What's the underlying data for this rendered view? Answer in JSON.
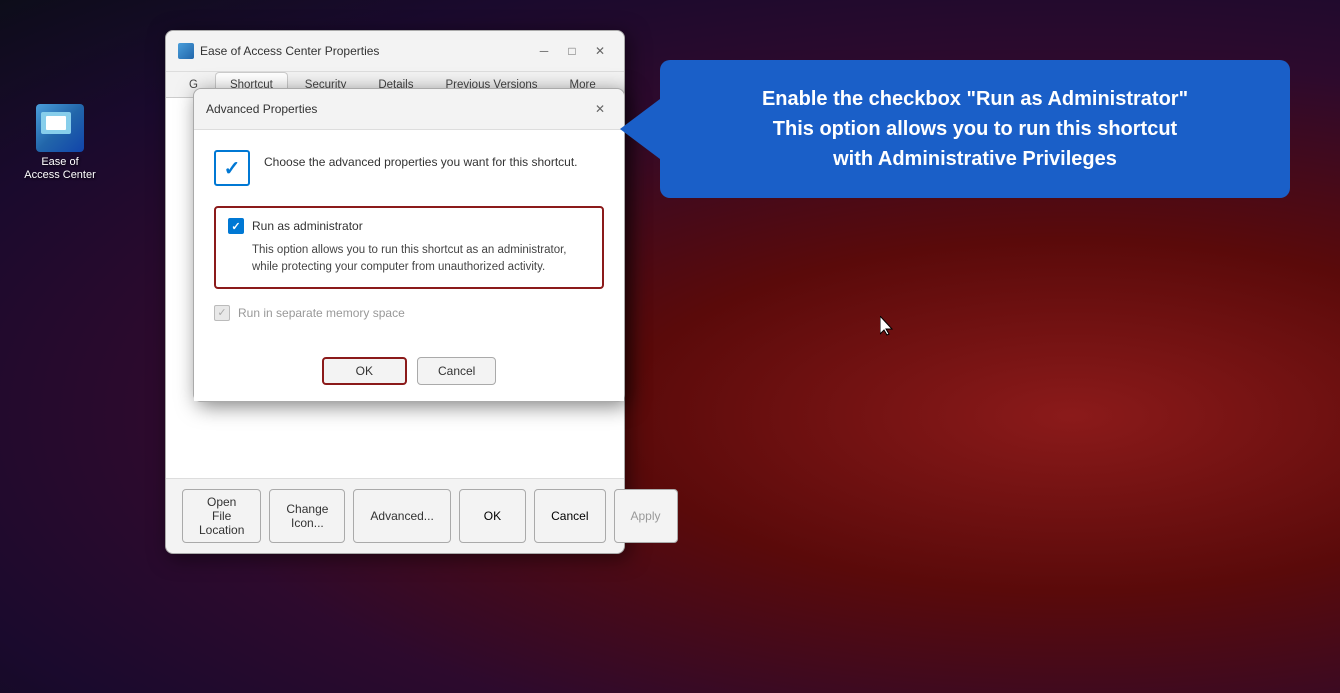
{
  "desktop": {
    "icon": {
      "label_line1": "Ease of",
      "label_line2": "Access Center"
    }
  },
  "main_dialog": {
    "title": "Ease of Access Center Properties",
    "tabs": [
      "General",
      "Shortcut",
      "Security",
      "Details",
      "Previous Versions",
      "More"
    ],
    "buttons": {
      "open_file_location": "Open File Location",
      "change_icon": "Change Icon...",
      "advanced": "Advanced...",
      "ok": "OK",
      "cancel": "Cancel",
      "apply": "Apply"
    }
  },
  "advanced_dialog": {
    "title": "Advanced Properties",
    "header_text": "Choose the advanced properties you want for this shortcut.",
    "run_as_admin_label": "Run as administrator",
    "run_as_admin_description": "This option allows you to run this shortcut as an administrator, while protecting your computer from unauthorized activity.",
    "run_separate_memory_label": "Run in separate memory space",
    "buttons": {
      "ok": "OK",
      "cancel": "Cancel"
    }
  },
  "callout": {
    "line1": "Enable the checkbox \"Run as Administrator\"",
    "line2": "This option allows you to run this shortcut",
    "line3": "with Administrative Privileges"
  }
}
